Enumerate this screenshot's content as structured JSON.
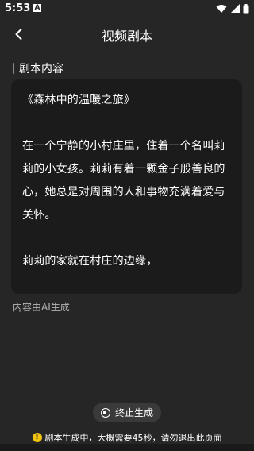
{
  "status": {
    "time": "5:53",
    "app_icon_letter": "A"
  },
  "header": {
    "title": "视频剧本"
  },
  "section": {
    "label": "剧本内容"
  },
  "content": {
    "title": "《森林中的温暖之旅》",
    "lines": [
      "在一个宁静的小村庄里，住着一个名叫莉",
      "莉的小女孩。莉莉有着一颗金子般善良的",
      "心，她总是对周围的人和事物充满着爱与",
      "关怀。",
      "莉莉的家就在村庄的边缘，"
    ]
  },
  "ai_note": "内容由AI生成",
  "stop_button": {
    "label": "终止生成"
  },
  "warning": {
    "text": "剧本生成中，大概需要45秒，请勿退出此页面"
  }
}
